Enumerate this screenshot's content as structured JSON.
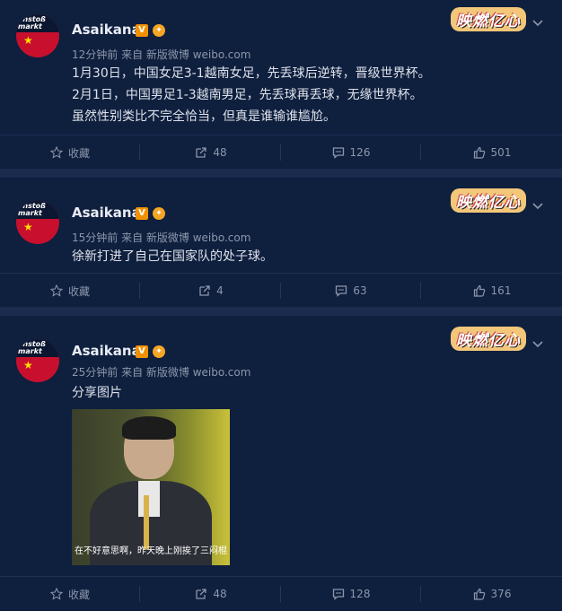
{
  "posts": [
    {
      "user": "Asaikana",
      "verified": "V",
      "title_badge": "映燃亿心",
      "meta": "12分钟前 来自 新版微博 weibo.com",
      "lines": [
        "1月30日，中国女足3-1越南女足，先丢球后逆转，晋级世界杯。",
        "2月1日，中国男足1-3越南男足，先丢球再丢球，无缘世界杯。",
        "虽然性别类比不完全恰当，但真是谁输谁尴尬。"
      ],
      "actions": {
        "fav": "收藏",
        "repost": "48",
        "comment": "126",
        "like": "501"
      }
    },
    {
      "user": "Asaikana",
      "verified": "V",
      "title_badge": "映燃亿心",
      "meta": "15分钟前 来自 新版微博 weibo.com",
      "lines": [
        "徐新打进了自己在国家队的处子球。"
      ],
      "actions": {
        "fav": "收藏",
        "repost": "4",
        "comment": "63",
        "like": "161"
      }
    },
    {
      "user": "Asaikana",
      "verified": "V",
      "title_badge": "映燃亿心",
      "meta": "25分钟前 来自 新版微博 weibo.com",
      "lines": [
        "分享图片"
      ],
      "image_caption": "在不好意思啊，昨天晚上刚挨了三闷棍",
      "actions": {
        "fav": "收藏",
        "repost": "48",
        "comment": "128",
        "like": "376"
      }
    }
  ],
  "avatar_text": "anstoß markt",
  "colors": {
    "bg": "#0f1f3e",
    "separator": "#1a2b4d",
    "meta": "#8c97ab",
    "accent": "#f29100"
  }
}
